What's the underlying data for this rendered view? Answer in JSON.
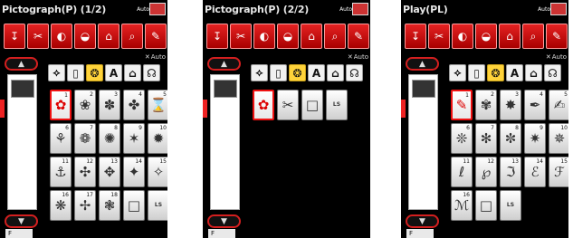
{
  "screens": [
    {
      "title": "Pictograph(P) (1/2)",
      "auto_label": "Auto",
      "sx_auto_label": "Auto",
      "bottom_badge": "F",
      "categories": [
        {
          "label": "⟡",
          "active": false
        },
        {
          "label": "▯",
          "active": false
        },
        {
          "label": "❂",
          "active": true
        },
        {
          "label": "A",
          "active": false
        },
        {
          "label": "⌂",
          "active": false
        },
        {
          "label": "☊",
          "active": false
        }
      ],
      "tiles": [
        {
          "num": "1",
          "glyph": "✿",
          "selected": true
        },
        {
          "num": "2",
          "glyph": "❀",
          "selected": false
        },
        {
          "num": "3",
          "glyph": "✽",
          "selected": false
        },
        {
          "num": "4",
          "glyph": "✤",
          "selected": false
        },
        {
          "num": "5",
          "glyph": "⌛",
          "selected": false
        },
        {
          "num": "6",
          "glyph": "⚘",
          "selected": false
        },
        {
          "num": "7",
          "glyph": "❁",
          "selected": false
        },
        {
          "num": "8",
          "glyph": "✺",
          "selected": false
        },
        {
          "num": "9",
          "glyph": "✶",
          "selected": false
        },
        {
          "num": "10",
          "glyph": "✹",
          "selected": false
        },
        {
          "num": "11",
          "glyph": "⚓",
          "selected": false
        },
        {
          "num": "12",
          "glyph": "✣",
          "selected": false
        },
        {
          "num": "13",
          "glyph": "✥",
          "selected": false
        },
        {
          "num": "14",
          "glyph": "✦",
          "selected": false
        },
        {
          "num": "15",
          "glyph": "✧",
          "selected": false
        },
        {
          "num": "16",
          "glyph": "❋",
          "selected": false
        },
        {
          "num": "17",
          "glyph": "✢",
          "selected": false
        },
        {
          "num": "18",
          "glyph": "❃",
          "selected": false
        },
        {
          "num": "",
          "glyph": "□",
          "selected": false
        },
        {
          "num": "",
          "glyph": "LS",
          "selected": false
        }
      ]
    },
    {
      "title": "Pictograph(P) (2/2)",
      "auto_label": "Auto",
      "sx_auto_label": "Auto",
      "bottom_badge": "F",
      "categories": [
        {
          "label": "⟡",
          "active": false
        },
        {
          "label": "▯",
          "active": false
        },
        {
          "label": "❂",
          "active": true
        },
        {
          "label": "A",
          "active": false
        },
        {
          "label": "⌂",
          "active": false
        },
        {
          "label": "☊",
          "active": false
        }
      ],
      "tiles": [
        {
          "num": "",
          "glyph": "✿",
          "selected": true
        },
        {
          "num": "",
          "glyph": "✂",
          "selected": false
        },
        {
          "num": "",
          "glyph": "□",
          "selected": false
        },
        {
          "num": "",
          "glyph": "LS",
          "selected": false
        }
      ]
    },
    {
      "title": "Play(PL)",
      "auto_label": "Auto",
      "sx_auto_label": "Auto",
      "bottom_badge": "F",
      "categories": [
        {
          "label": "⟡",
          "active": false
        },
        {
          "label": "▯",
          "active": false
        },
        {
          "label": "❂",
          "active": true
        },
        {
          "label": "A",
          "active": false
        },
        {
          "label": "⌂",
          "active": false
        },
        {
          "label": "☊",
          "active": false
        }
      ],
      "tiles": [
        {
          "num": "1",
          "glyph": "✎",
          "selected": true
        },
        {
          "num": "2",
          "glyph": "✾",
          "selected": false
        },
        {
          "num": "3",
          "glyph": "✸",
          "selected": false
        },
        {
          "num": "4",
          "glyph": "✒",
          "selected": false
        },
        {
          "num": "5",
          "glyph": "✍",
          "selected": false
        },
        {
          "num": "6",
          "glyph": "❊",
          "selected": false
        },
        {
          "num": "7",
          "glyph": "✻",
          "selected": false
        },
        {
          "num": "8",
          "glyph": "✼",
          "selected": false
        },
        {
          "num": "9",
          "glyph": "✷",
          "selected": false
        },
        {
          "num": "10",
          "glyph": "✵",
          "selected": false
        },
        {
          "num": "11",
          "glyph": "ℓ",
          "selected": false
        },
        {
          "num": "12",
          "glyph": "℘",
          "selected": false
        },
        {
          "num": "13",
          "glyph": "ℑ",
          "selected": false
        },
        {
          "num": "14",
          "glyph": "ℰ",
          "selected": false
        },
        {
          "num": "15",
          "glyph": "ℱ",
          "selected": false
        },
        {
          "num": "16",
          "glyph": "ℳ",
          "selected": false
        },
        {
          "num": "",
          "glyph": "□",
          "selected": false
        },
        {
          "num": "",
          "glyph": "LS",
          "selected": false
        }
      ]
    }
  ],
  "toolbar_icons": [
    "↧",
    "✂",
    "◐",
    "◒",
    "⌂",
    "⌕",
    "✎"
  ]
}
